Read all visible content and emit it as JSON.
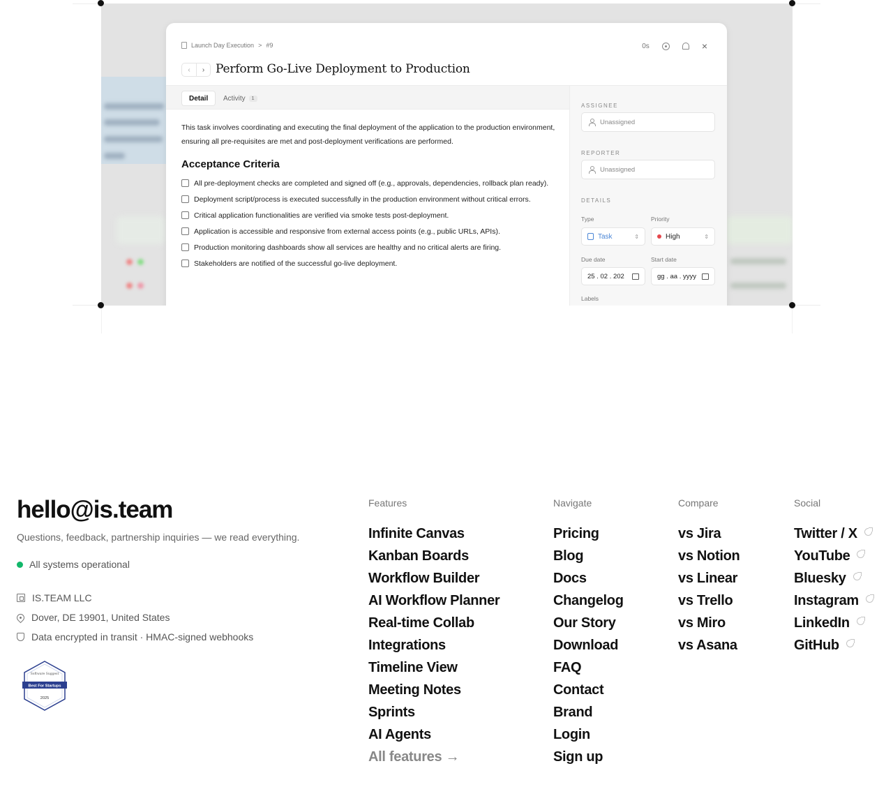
{
  "modal": {
    "breadcrumb_project": "Launch Day Execution",
    "breadcrumb_sep": ">",
    "breadcrumb_id": "#9",
    "timer": "0s",
    "close": "×",
    "nav_prev": "‹",
    "nav_next": "›",
    "title": "Perform Go-Live Deployment to Production",
    "tabs": [
      {
        "label": "Detail"
      },
      {
        "label": "Activity",
        "count": "1"
      }
    ],
    "description": "This task involves coordinating and executing the final deployment of the application to the production environment, ensuring all pre-requisites are met and post-deployment verifications are performed.",
    "criteria_title": "Acceptance Criteria",
    "criteria": [
      "All pre-deployment checks are completed and signed off (e.g., approvals, dependencies, rollback plan ready).",
      "Deployment script/process is executed successfully in the production environment without critical errors.",
      "Critical application functionalities are verified via smoke tests post-deployment.",
      "Application is accessible and responsive from external access points (e.g., public URLs, APIs).",
      "Production monitoring dashboards show all services are healthy and no critical alerts are firing.",
      "Stakeholders are notified of the successful go-live deployment."
    ],
    "sidebar": {
      "assignee_heading": "ASSIGNEE",
      "assignee_value": "Unassigned",
      "reporter_heading": "REPORTER",
      "reporter_value": "Unassigned",
      "details_heading": "DETAILS",
      "type_label": "Type",
      "type_value": "Task",
      "priority_label": "Priority",
      "priority_value": "High",
      "due_label": "Due date",
      "due_value": "25 . 02 . 202",
      "start_label": "Start date",
      "start_value": "gg . aa . yyyy",
      "labels_label": "Labels"
    }
  },
  "footer": {
    "email": "hello@is.team",
    "tagline": "Questions, feedback, partnership inquiries — we read everything.",
    "status": "All systems operational",
    "company": "IS.TEAM LLC",
    "address": "Dover, DE 19901, United States",
    "security": "Data encrypted in transit · HMAC-signed webhooks",
    "badge": {
      "brand": "Software Suggest",
      "title": "Best For Startups",
      "year": "2025"
    },
    "columns": {
      "features": {
        "heading": "Features",
        "links": [
          "Infinite Canvas",
          "Kanban Boards",
          "Workflow Builder",
          "AI Workflow Planner",
          "Real-time Collab",
          "Integrations",
          "Timeline View",
          "Meeting Notes",
          "Sprints",
          "AI Agents"
        ],
        "all_link": "All features →"
      },
      "navigate": {
        "heading": "Navigate",
        "links": [
          "Pricing",
          "Blog",
          "Docs",
          "Changelog",
          "Our Story",
          "Download",
          "FAQ",
          "Contact",
          "Brand",
          "Login",
          "Sign up"
        ]
      },
      "compare": {
        "heading": "Compare",
        "links": [
          "vs Jira",
          "vs Notion",
          "vs Linear",
          "vs Trello",
          "vs Miro",
          "vs Asana"
        ]
      },
      "social": {
        "heading": "Social",
        "links": [
          "Twitter / X",
          "YouTube",
          "Bluesky",
          "Instagram",
          "LinkedIn",
          "GitHub"
        ]
      }
    }
  },
  "colors": {
    "status_green": "#12b76a",
    "priority_red": "#e5484d",
    "task_blue": "#4a86d6"
  }
}
